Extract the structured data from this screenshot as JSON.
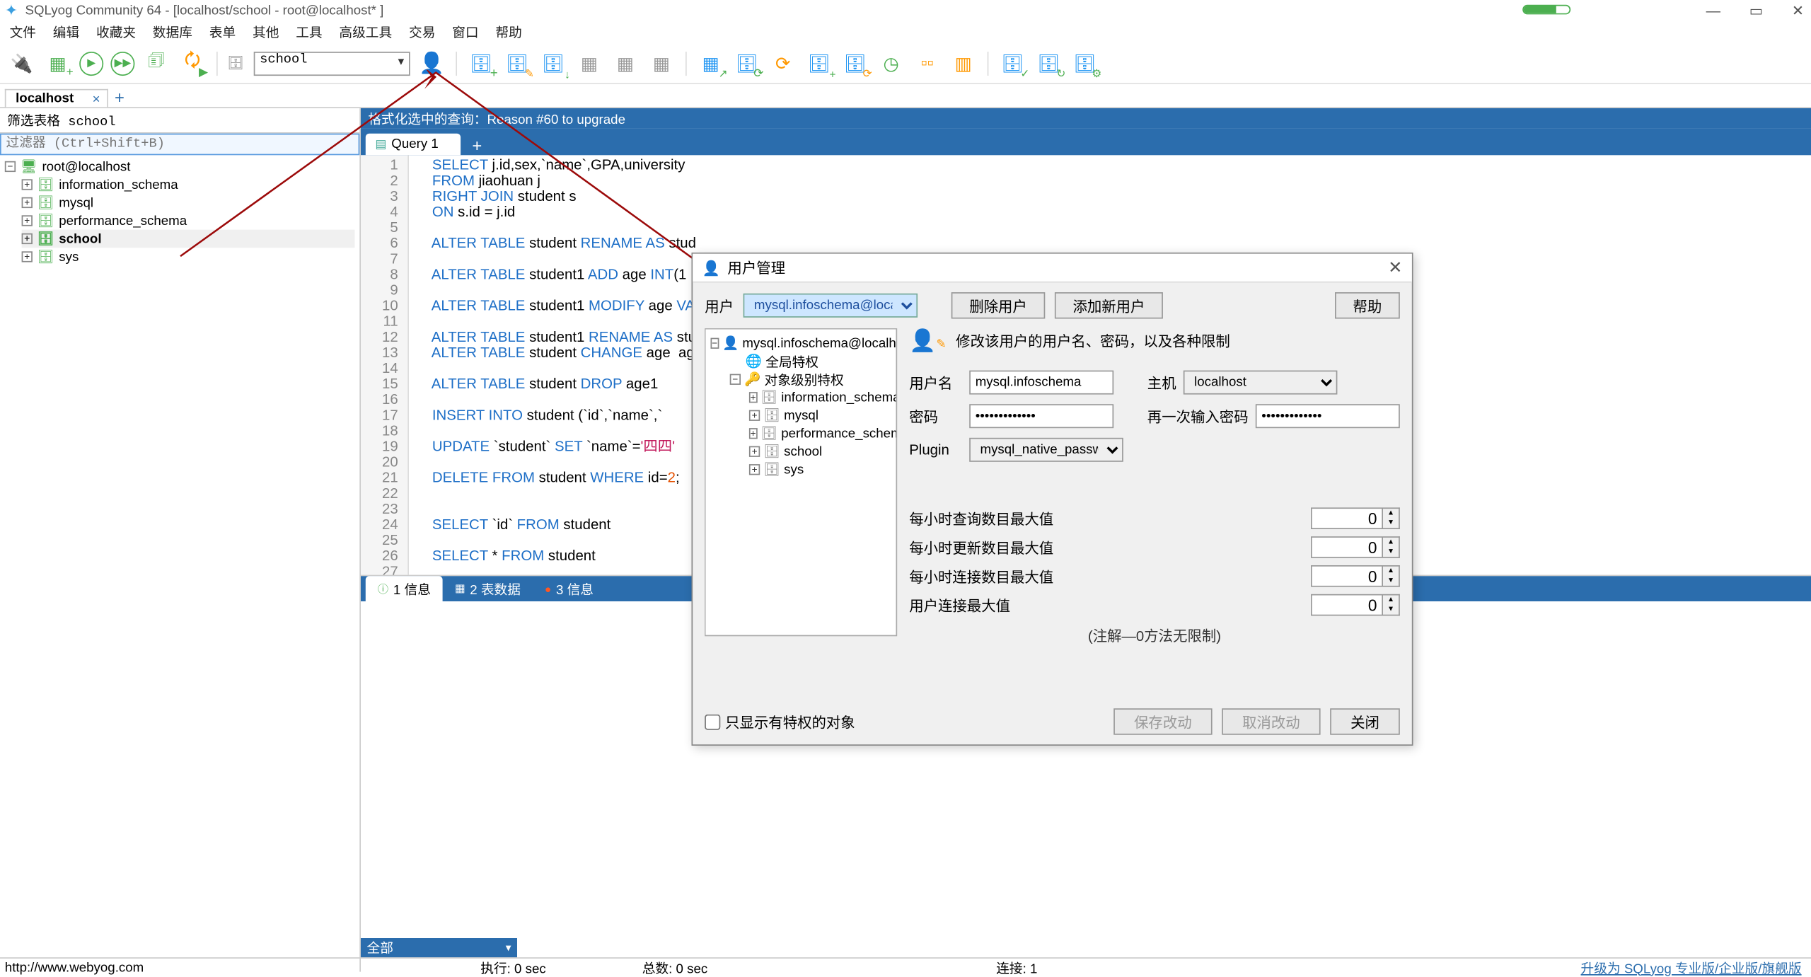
{
  "app": {
    "title": "SQLyog Community 64 - [localhost/school - root@localhost* ]"
  },
  "menus": [
    "文件",
    "编辑",
    "收藏夹",
    "数据库",
    "表单",
    "其他",
    "工具",
    "高级工具",
    "交易",
    "窗口",
    "帮助"
  ],
  "toolbar": {
    "db_selected": "school"
  },
  "conn_tabs": {
    "active": "localhost"
  },
  "sidebar": {
    "filter_label": "筛选表格 school",
    "filter_placeholder": "过滤器 (Ctrl+Shift+B)",
    "root": "root@localhost",
    "dbs": [
      "information_schema",
      "mysql",
      "performance_schema",
      "school",
      "sys"
    ]
  },
  "editor": {
    "fmt_hint": "格式化选中的查询：Reason #60 to upgrade",
    "tab": "Query 1",
    "lines": [
      {
        "n": 1,
        "html": "<span class='kw'>SELECT</span> j.id,sex,`name`,GPA,university"
      },
      {
        "n": 2,
        "html": "<span class='kw'>FROM</span> jiaohuan j"
      },
      {
        "n": 3,
        "html": "<span class='kw'>RIGHT JOIN</span> student s"
      },
      {
        "n": 4,
        "html": "<span class='kw'>ON</span> s.id = j.id"
      },
      {
        "n": 5,
        "html": ""
      },
      {
        "n": 6,
        "html": "<span class='kw'>ALTER TABLE</span> student <span class='kw'>RENAME AS</span> stud"
      },
      {
        "n": 7,
        "html": ""
      },
      {
        "n": 8,
        "html": "<span class='kw'>ALTER TABLE</span> student1 <span class='kw'>ADD</span> age <span class='kw'>INT</span>(1"
      },
      {
        "n": 9,
        "html": ""
      },
      {
        "n": 10,
        "html": "<span class='kw'>ALTER TABLE</span> student1 <span class='kw'>MODIFY</span> age <span class='kw'>VA</span>"
      },
      {
        "n": 11,
        "html": ""
      },
      {
        "n": 12,
        "html": "<span class='kw'>ALTER TABLE</span> student1 <span class='kw'>RENAME AS</span> stu"
      },
      {
        "n": 13,
        "html": "<span class='kw'>ALTER TABLE</span> student <span class='kw'>CHANGE</span> age  ag"
      },
      {
        "n": 14,
        "html": ""
      },
      {
        "n": 15,
        "html": "<span class='kw'>ALTER TABLE</span> student <span class='kw'>DROP</span> age1"
      },
      {
        "n": 16,
        "html": ""
      },
      {
        "n": 17,
        "html": "<span class='kw'>INSERT INTO</span> student (`id`,`name`,`"
      },
      {
        "n": 18,
        "html": ""
      },
      {
        "n": 19,
        "html": "<span class='kw'>UPDATE</span> `student` <span class='kw'>SET</span> `name`=<span class='str'>'四四'</span>"
      },
      {
        "n": 20,
        "html": ""
      },
      {
        "n": 21,
        "html": "<span class='kw'>DELETE FROM</span> student <span class='kw'>WHERE</span> id=<span class='num'>2</span>;"
      },
      {
        "n": 22,
        "html": ""
      },
      {
        "n": 23,
        "html": ""
      },
      {
        "n": 24,
        "html": "<span class='kw'>SELECT</span> `id` <span class='kw'>FROM</span> student"
      },
      {
        "n": 25,
        "html": ""
      },
      {
        "n": 26,
        "html": "<span class='kw'>SELECT</span> * <span class='kw'>FROM</span> student"
      },
      {
        "n": 27,
        "html": ""
      }
    ]
  },
  "result_tabs": [
    {
      "ico": "ⓘ",
      "ico_color": "#4caf50",
      "label": "1 信息",
      "active": true
    },
    {
      "ico": "▦",
      "ico_color": "#fff",
      "label": "2 表数据"
    },
    {
      "ico": "●",
      "ico_color": "#ff5722",
      "label": "3 信息"
    }
  ],
  "lower_filter": "全部",
  "status": {
    "url": "http://www.webyog.com",
    "exec": "执行: 0 sec",
    "total": "总数: 0 sec",
    "conn": "连接: 1",
    "upgrade": "升级为 SQLyog 专业版/企业版/旗舰版"
  },
  "dialog": {
    "title": "用户管理",
    "user_label": "用户",
    "user_value": "mysql.infoschema@localhost",
    "btn_delete": "删除用户",
    "btn_add": "添加新用户",
    "btn_help": "帮助",
    "tree_root": "mysql.infoschema@localhost",
    "tree_global": "全局特权",
    "tree_obj": "对象级别特权",
    "tree_dbs": [
      "information_schema",
      "mysql",
      "performance_schema",
      "school",
      "sys"
    ],
    "form_head": "修改该用户的用户名、密码，以及各种限制",
    "lbl_username": "用户名",
    "val_username": "mysql.infoschema",
    "lbl_host": "主机",
    "val_host": "localhost",
    "lbl_pwd": "密码",
    "val_pwd": "●●●●●●●●●●●●●",
    "lbl_pwd2": "再一次输入密码",
    "val_pwd2": "●●●●●●●●●●●●●",
    "lbl_plugin": "Plugin",
    "val_plugin": "mysql_native_password",
    "limits": [
      {
        "label": "每小时查询数目最大值",
        "val": "0"
      },
      {
        "label": "每小时更新数目最大值",
        "val": "0"
      },
      {
        "label": "每小时连接数目最大值",
        "val": "0"
      },
      {
        "label": "用户连接最大值",
        "val": "0"
      }
    ],
    "note": "(注解—0方法无限制)",
    "cb_label": "只显示有特权的对象",
    "btn_save": "保存改动",
    "btn_cancel": "取消改动",
    "btn_close": "关闭"
  }
}
